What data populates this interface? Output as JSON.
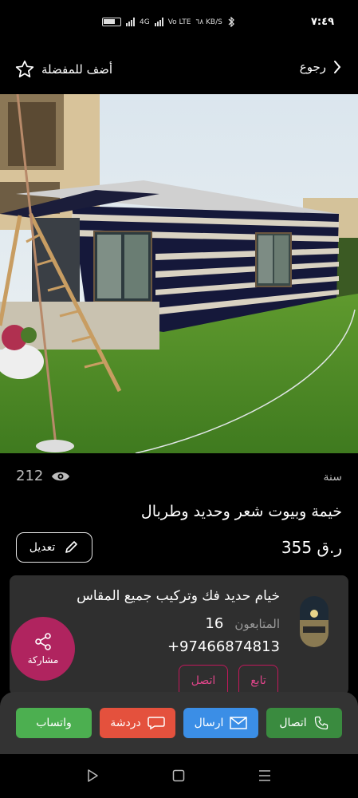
{
  "status": {
    "time": "٧:٤٩",
    "network": "4G",
    "volte": "Vo LTE",
    "speed": "٦٨ KB/S"
  },
  "topbar": {
    "favorite_label": "أضف للمفضلة",
    "back_label": "رجوع"
  },
  "listing": {
    "views": "212",
    "year_label": "سنة",
    "title": "خيمة وبيوت شعر وحديد وطربال",
    "price": "355 ر.ق",
    "edit_label": "تعديل"
  },
  "seller": {
    "name": "خيام حديد فك وتركيب جميع المقاس",
    "followers_label": "المتابعون",
    "followers_count": "16",
    "phone": "+97466874813",
    "follow_label": "تابع",
    "contact_label": "اتصل"
  },
  "share": {
    "label": "مشاركة"
  },
  "actions": {
    "whatsapp": "واتساب",
    "chat": "دردشة",
    "send": "ارسال",
    "call": "اتصال"
  },
  "colors": {
    "accent": "#c2185b",
    "whatsapp": "#4caf50",
    "chat": "#e4513d",
    "send": "#3b8ee6",
    "call": "#3a8b3f"
  }
}
